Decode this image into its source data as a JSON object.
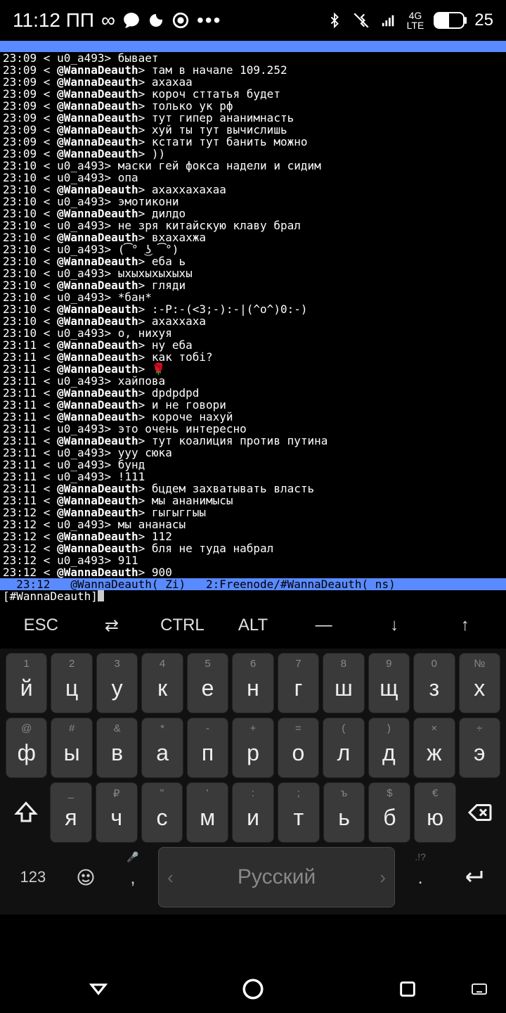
{
  "status": {
    "time": "11:12 ПП",
    "battery": "25",
    "net": "4G LTE"
  },
  "chat": [
    {
      "t": "23:09",
      "u": "u0_a493",
      "m": "бывает",
      "op": false
    },
    {
      "t": "23:09",
      "u": "@WannaDeauth",
      "m": "там в начале 109.252",
      "op": true
    },
    {
      "t": "23:09",
      "u": "@WannaDeauth",
      "m": "ахахаа",
      "op": true
    },
    {
      "t": "23:09",
      "u": "@WannaDeauth",
      "m": "короч сттатья будет",
      "op": true
    },
    {
      "t": "23:09",
      "u": "@WannaDeauth",
      "m": "только ук рф",
      "op": true
    },
    {
      "t": "23:09",
      "u": "@WannaDeauth",
      "m": "тут гипер ананимнасть",
      "op": true
    },
    {
      "t": "23:09",
      "u": "@WannaDeauth",
      "m": "хуй ты тут вычислишь",
      "op": true
    },
    {
      "t": "23:09",
      "u": "@WannaDeauth",
      "m": "кстати тут банить можно",
      "op": true
    },
    {
      "t": "23:09",
      "u": "@WannaDeauth",
      "m": "))",
      "op": true
    },
    {
      "t": "23:10",
      "u": "u0_a493",
      "m": "маски гей фокса надели и сидим",
      "op": false
    },
    {
      "t": "23:10",
      "u": "u0_a493",
      "m": "опа",
      "op": false
    },
    {
      "t": "23:10",
      "u": "@WannaDeauth",
      "m": "ахаххахахаа",
      "op": true
    },
    {
      "t": "23:10",
      "u": "u0_a493",
      "m": "эмотикони",
      "op": false
    },
    {
      "t": "23:10",
      "u": "@WannaDeauth",
      "m": "дилдо",
      "op": true
    },
    {
      "t": "23:10",
      "u": "u0_a493",
      "m": "не зря китайскую клаву брал",
      "op": false
    },
    {
      "t": "23:10",
      "u": "@WannaDeauth",
      "m": "вхахахжа",
      "op": true
    },
    {
      "t": "23:10",
      "u": "u0_a493",
      "m": "(͡° ͜ʖ ͡°)",
      "op": false
    },
    {
      "t": "23:10",
      "u": "@WannaDeauth",
      "m": "еба ь",
      "op": true
    },
    {
      "t": "23:10",
      "u": "u0_a493",
      "m": "ыхыхыхыхыхы",
      "op": false
    },
    {
      "t": "23:10",
      "u": "@WannaDeauth",
      "m": "гляди",
      "op": true
    },
    {
      "t": "23:10",
      "u": "u0_a493",
      "m": "*бан*",
      "op": false
    },
    {
      "t": "23:10",
      "u": "@WannaDeauth",
      "m": ":-P:-(<3;-):-|(^o^)0:-)",
      "op": true
    },
    {
      "t": "23:10",
      "u": "@WannaDeauth",
      "m": "ахаххаха",
      "op": true
    },
    {
      "t": "23:10",
      "u": "u0_a493",
      "m": "о, нихуя",
      "op": false
    },
    {
      "t": "23:11",
      "u": "@WannaDeauth",
      "m": "ну еба",
      "op": true
    },
    {
      "t": "23:11",
      "u": "@WannaDeauth",
      "m": "как тобі?",
      "op": true
    },
    {
      "t": "23:11",
      "u": "@WannaDeauth",
      "m": "🌹",
      "op": true
    },
    {
      "t": "23:11",
      "u": "u0_a493",
      "m": "хайпова",
      "op": false
    },
    {
      "t": "23:11",
      "u": "@WannaDeauth",
      "m": "dpdpdpd",
      "op": true
    },
    {
      "t": "23:11",
      "u": "@WannaDeauth",
      "m": "и не говори",
      "op": true
    },
    {
      "t": "23:11",
      "u": "@WannaDeauth",
      "m": "короче нахуй",
      "op": true
    },
    {
      "t": "23:11",
      "u": "u0_a493",
      "m": "это очень интересно",
      "op": false
    },
    {
      "t": "23:11",
      "u": "@WannaDeauth",
      "m": "тут коалиция против путина",
      "op": true
    },
    {
      "t": "23:11",
      "u": "u0_a493",
      "m": "ууу сюка",
      "op": false
    },
    {
      "t": "23:11",
      "u": "u0_a493",
      "m": "бунд",
      "op": false
    },
    {
      "t": "23:11",
      "u": "u0_a493",
      "m": "!111",
      "op": false
    },
    {
      "t": "23:11",
      "u": "@WannaDeauth",
      "m": "бцдем захватывать власть",
      "op": true
    },
    {
      "t": "23:11",
      "u": "@WannaDeauth",
      "m": "мы ананимысы",
      "op": true
    },
    {
      "t": "23:12",
      "u": "@WannaDeauth",
      "m": "гыгыггыы",
      "op": true
    },
    {
      "t": "23:12",
      "u": "u0_a493",
      "m": "мы ананасы",
      "op": false
    },
    {
      "t": "23:12",
      "u": "@WannaDeauth",
      "m": "112",
      "op": true
    },
    {
      "t": "23:12",
      "u": "@WannaDeauth",
      "m": "бля не туда набрал",
      "op": true
    },
    {
      "t": "23:12",
      "u": "u0_a493",
      "m": "911",
      "op": false
    },
    {
      "t": "23:12",
      "u": "@WannaDeauth",
      "m": "900",
      "op": true
    }
  ],
  "statusline": "  23:12   @WannaDeauth( Zi)   2:Freenode/#WannaDeauth( ns)",
  "inputprompt": "[#WannaDeauth] ",
  "extrakeys": [
    "ESC",
    "⇄",
    "CTRL",
    "ALT",
    "—",
    "↓",
    "↑"
  ],
  "kb": {
    "row1": [
      {
        "h": "1",
        "m": "й"
      },
      {
        "h": "2",
        "m": "ц"
      },
      {
        "h": "3",
        "m": "у"
      },
      {
        "h": "4",
        "m": "к"
      },
      {
        "h": "5",
        "m": "е"
      },
      {
        "h": "6",
        "m": "н"
      },
      {
        "h": "7",
        "m": "г"
      },
      {
        "h": "8",
        "m": "ш"
      },
      {
        "h": "9",
        "m": "щ"
      },
      {
        "h": "0",
        "m": "з"
      },
      {
        "h": "№",
        "m": "х"
      }
    ],
    "row2": [
      {
        "h": "@",
        "m": "ф"
      },
      {
        "h": "#",
        "m": "ы"
      },
      {
        "h": "&",
        "m": "в"
      },
      {
        "h": "*",
        "m": "а"
      },
      {
        "h": "-",
        "m": "п"
      },
      {
        "h": "+",
        "m": "р"
      },
      {
        "h": "=",
        "m": "о"
      },
      {
        "h": "(",
        "m": "л"
      },
      {
        "h": ")",
        "m": "д"
      },
      {
        "h": "×",
        "m": "ж"
      },
      {
        "h": "÷",
        "m": "э"
      }
    ],
    "row3": [
      {
        "h": "_",
        "m": "я"
      },
      {
        "h": "₽",
        "m": "ч"
      },
      {
        "h": "\"",
        "m": "с"
      },
      {
        "h": "'",
        "m": "м"
      },
      {
        "h": ":",
        "m": "и"
      },
      {
        "h": ";",
        "m": "т"
      },
      {
        "h": "ъ",
        "m": "ь"
      },
      {
        "h": "$",
        "m": "б"
      },
      {
        "h": "€",
        "m": "ю"
      }
    ],
    "bottom": {
      "num": "123",
      "space": "Русский",
      "space_hint_l": "🎤",
      "space_hint_r": ".!?",
      "comma_hint": ",",
      "comma": " "
    }
  }
}
